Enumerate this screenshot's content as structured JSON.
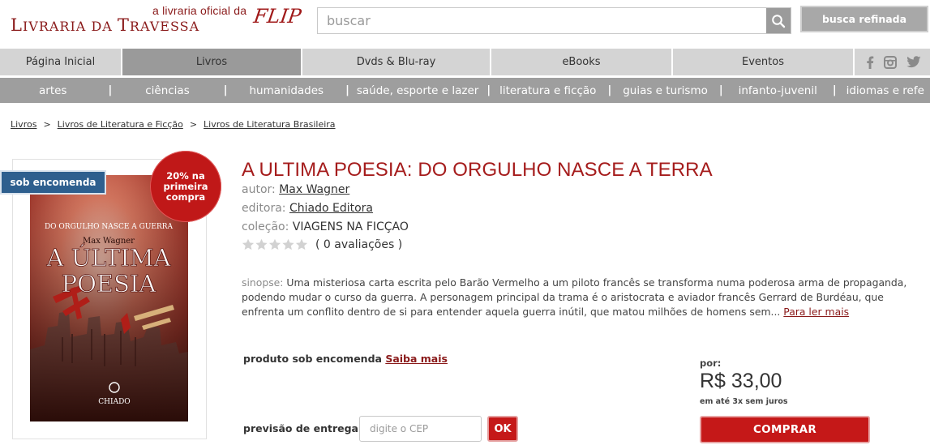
{
  "header": {
    "logo_tagline": "a livraria oficial da",
    "logo_main_1": "L",
    "logo_main_2": "IVRARIA DA ",
    "logo_main_3": "T",
    "logo_main_4": "RAVESSA",
    "logo_flip": "FLIP",
    "search_placeholder": "buscar",
    "refine_label": "busca refinada"
  },
  "main_nav": {
    "tabs": [
      {
        "label": "Página Inicial",
        "active": false
      },
      {
        "label": "Livros",
        "active": true
      },
      {
        "label": "Dvds & Blu-ray",
        "active": false
      },
      {
        "label": "eBooks",
        "active": false
      },
      {
        "label": "Eventos",
        "active": false
      }
    ],
    "social": [
      "facebook-icon",
      "instagram-icon",
      "twitter-icon"
    ]
  },
  "sub_nav": {
    "categories": [
      "artes",
      "ciências",
      "humanidades",
      "saúde, esporte e lazer",
      "literatura e ficção",
      "guias e turismo",
      "infanto-juvenil",
      "idiomas e refe"
    ],
    "separator": "|"
  },
  "breadcrumb": {
    "items": [
      "Livros",
      "Livros de Literatura e Ficção",
      "Livros de Literatura Brasileira"
    ],
    "separator": ">"
  },
  "badges": {
    "order": "sob encomenda",
    "discount_line1": "20% na",
    "discount_line2": "primeira",
    "discount_line3": "compra"
  },
  "cover": {
    "subtitle": "DO ORGULHO NASCE A GUERRA",
    "author": "Max Wagner",
    "title_line1": "A ÚLTIMA",
    "title_line2": "POESIA",
    "publisher": "CHIADO"
  },
  "product": {
    "title": "A ULTIMA POESIA: DO ORGULHO NASCE A TERRA",
    "author_label": "autor:",
    "author": "Max Wagner",
    "publisher_label": "editora:",
    "publisher": "Chiado Editora",
    "collection_label": "coleção:",
    "collection": "VIAGENS NA FICÇAO",
    "rating": 0,
    "reviews": "( 0 avaliações )",
    "synopsis_label": "sinopse:",
    "synopsis": " Uma misteriosa carta escrita pelo Barão Vermelho a um piloto francês se transforma numa poderosa arma de propaganda, podendo mudar o curso da guerra. A personagem principal da trama é o aristocrata e aviador francês Gerrard de Burdéau, que enfrenta um conflito dentro de si para entender aquela guerra inútil, que matou milhões de homens sem... ",
    "read_more": "Para ler mais"
  },
  "purchase": {
    "order_note": "produto sob encomenda ",
    "learn_more": "Saiba mais",
    "price_label": "por:",
    "price": "R$ 33,00",
    "installments": "em até 3x sem juros",
    "delivery_label": "previsão de entrega:",
    "cep_placeholder": "digite o CEP",
    "ok_label": "OK",
    "buy_label": "COMPRAR"
  },
  "colors": {
    "brand_red": "#a51c1c",
    "button_red": "#c51818",
    "badge_blue": "#2e5f8e",
    "nav_gray": "#d4d4d4",
    "subnav_gray": "#9e9e9e"
  }
}
